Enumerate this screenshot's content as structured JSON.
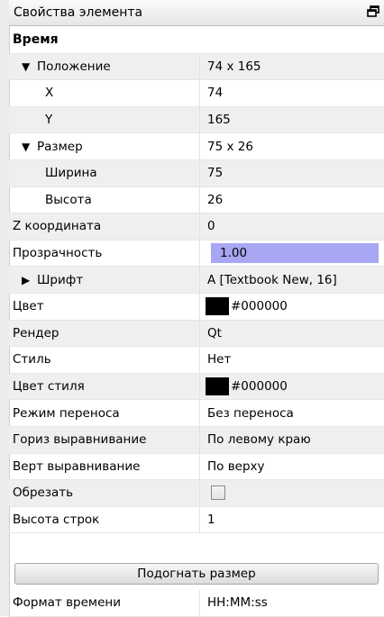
{
  "panel": {
    "title": "Свойства элемента"
  },
  "section": {
    "label": "Время"
  },
  "rows": [
    {
      "label": "Положение",
      "value": "74 x 165"
    },
    {
      "label": "X",
      "value": "74"
    },
    {
      "label": "Y",
      "value": "165"
    },
    {
      "label": "Размер",
      "value": "75 x 26"
    },
    {
      "label": "Ширина",
      "value": "75"
    },
    {
      "label": "Высота",
      "value": "26"
    },
    {
      "label": "Z координата",
      "value": "0"
    },
    {
      "label": "Прозрачность",
      "value": "1.00"
    },
    {
      "label": "Шрифт",
      "value": "A [Textbook New, 16]"
    },
    {
      "label": "Цвет",
      "value": "#000000"
    },
    {
      "label": "Рендер",
      "value": "Qt"
    },
    {
      "label": "Стиль",
      "value": "Нет"
    },
    {
      "label": "Цвет стиля",
      "value": "#000000"
    },
    {
      "label": "Режим переноса",
      "value": "Без переноса"
    },
    {
      "label": "Гориз выравнивание",
      "value": "По левому краю"
    },
    {
      "label": "Верт выравнивание",
      "value": "По верху"
    },
    {
      "label": "Обрезать",
      "value": ""
    },
    {
      "label": "Высота строк",
      "value": "1"
    },
    {
      "label": "Формат времени",
      "value": "HH:MM:ss"
    }
  ],
  "fit_button": {
    "label": "Подогнать размер"
  },
  "colors": {
    "selection": "#a7a7f4",
    "swatch": "#000000"
  },
  "icons": {
    "expanded": "triangle-down",
    "collapsed": "triangle-right",
    "float": "float-window-icon"
  }
}
